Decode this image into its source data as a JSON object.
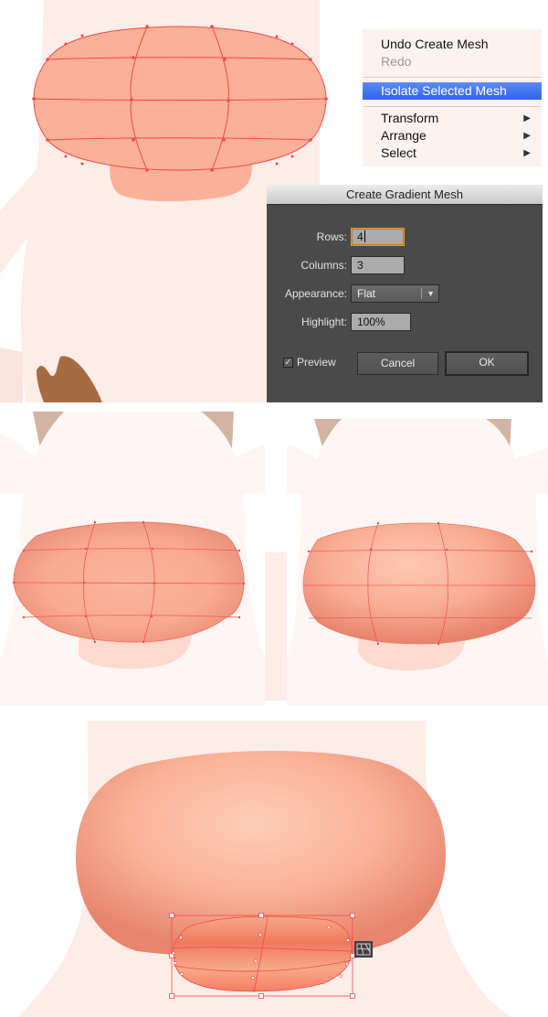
{
  "context_menu": {
    "items": [
      {
        "label": "Undo Create Mesh",
        "state": "enabled"
      },
      {
        "label": "Redo",
        "state": "disabled"
      },
      {
        "label": "Isolate Selected Mesh",
        "state": "highlighted"
      },
      {
        "label": "Transform",
        "submenu": true
      },
      {
        "label": "Arrange",
        "submenu": true
      },
      {
        "label": "Select",
        "submenu": true
      }
    ],
    "submenu_arrow": "▶"
  },
  "dialog": {
    "title": "Create Gradient Mesh",
    "rows_label": "Rows:",
    "rows_value": "4",
    "columns_label": "Columns:",
    "columns_value": "3",
    "appearance_label": "Appearance:",
    "appearance_value": "Flat",
    "highlight_label": "Highlight:",
    "highlight_value": "100%",
    "preview_label": "Preview",
    "preview_checked": true,
    "check_glyph": "✓",
    "dropdown_glyph": "▼",
    "cancel_label": "Cancel",
    "ok_label": "OK"
  },
  "canvas": {
    "colors": {
      "background_light": "#fcede9",
      "background_lighter": "#fdf6f4",
      "nose_flat": "#fbb197",
      "nose_mid": "#f7a78c",
      "nose_dark": "#e8866e",
      "nose_highlight": "#fdcab5",
      "nose_bottom": "#ef7f5e",
      "mesh_line": "#f4494b",
      "hoof_brown": "#a56b43",
      "horn_tan": "#d2b4a3",
      "chin_pink": "#fddad0"
    },
    "panels": [
      {
        "name": "flat-mesh-step",
        "mesh_rows": 4,
        "mesh_columns": 3
      },
      {
        "name": "shaded-mesh-left"
      },
      {
        "name": "shaded-mesh-right"
      },
      {
        "name": "final-nose-with-nostril-mesh"
      }
    ],
    "tool_icon": "gradient-mesh-icon"
  }
}
